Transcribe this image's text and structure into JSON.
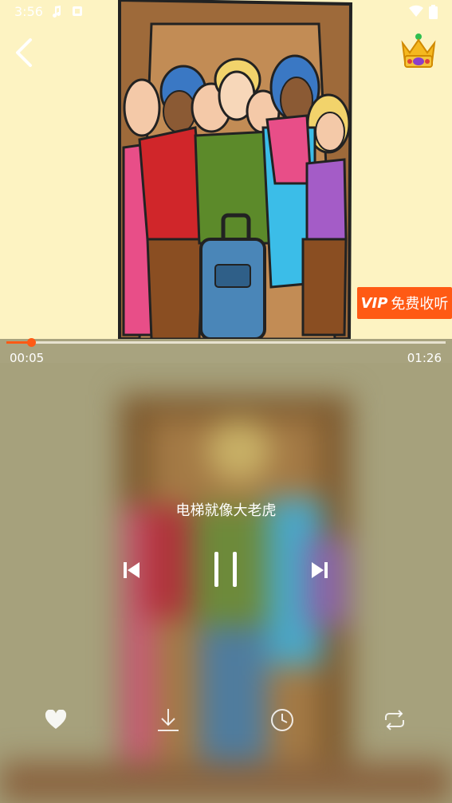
{
  "status_bar": {
    "time": "3:56"
  },
  "vip_button": {
    "vip": "VIP",
    "label": "免费收听"
  },
  "progress": {
    "current": "00:05",
    "total": "01:26",
    "fraction": 0.058
  },
  "track": {
    "title": "电梯就像大老虎"
  },
  "icons": {
    "back": "back-arrow-icon",
    "vip": "crown-icon",
    "prev": "skip-previous-icon",
    "pause": "pause-icon",
    "next": "skip-next-icon",
    "like": "heart-icon",
    "download": "download-icon",
    "timer": "clock-icon",
    "loop": "repeat-icon"
  },
  "colors": {
    "accent": "#ff5a14",
    "art_bg": "#fdf3c2",
    "player_bg": "#a8a37f"
  }
}
